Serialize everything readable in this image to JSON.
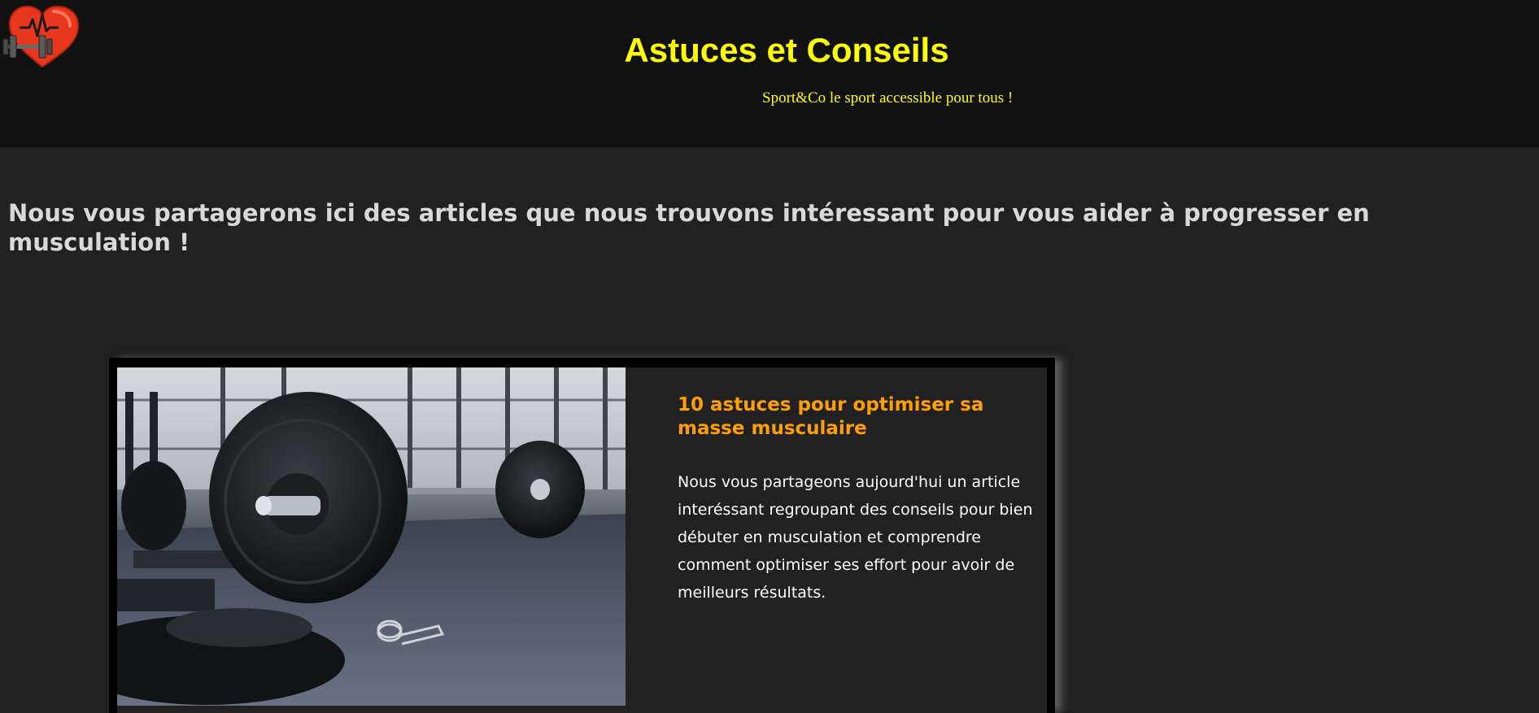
{
  "header": {
    "logo_icon": "heart-dumbbell-icon",
    "title": "Astuces et Conseils",
    "tagline": "Sport&Co le sport accessible pour tous !"
  },
  "main": {
    "intro": "Nous vous partagerons ici des articles que nous trouvons intéressant pour vous aider à progresser en musculation !",
    "articles": [
      {
        "image_icon": "barbell-plates-photo",
        "title": "10 astuces pour optimiser sa masse musculaire",
        "text": "Nous vous partageons aujourd'hui un article interéssant regroupant des conseils pour bien débuter en musculation et comprendre comment optimiser ses effort pour avoir de meilleurs résultats."
      }
    ]
  },
  "colors": {
    "header_bg": "#121112",
    "page_bg": "#212121",
    "title": "#ffff00",
    "article_title": "#ff9f00",
    "intro_text": "#d9d9d9"
  }
}
